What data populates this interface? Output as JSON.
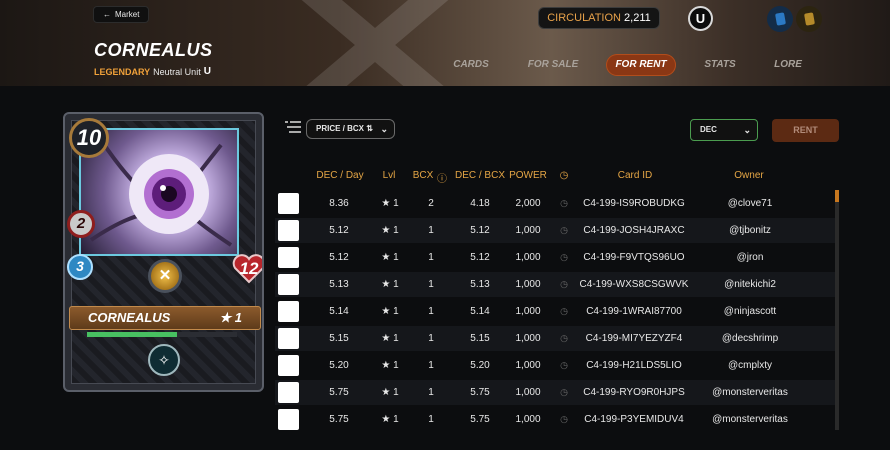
{
  "header": {
    "back_label": "Market",
    "title": "CORNEALUS",
    "rarity": "LEGENDARY",
    "unit_type": "Neutral Unit",
    "circulation_label": "CIRCULATION",
    "circulation_value": "2,211",
    "edition_glyph": "U",
    "tabs": [
      {
        "label": "CARDS",
        "active": false
      },
      {
        "label": "FOR SALE",
        "active": false
      },
      {
        "label": "FOR RENT",
        "active": true
      },
      {
        "label": "STATS",
        "active": false
      },
      {
        "label": "LORE",
        "active": false
      }
    ]
  },
  "card": {
    "mana": "10",
    "attack": "2",
    "speed": "3",
    "health": "12",
    "name": "CORNEALUS",
    "level": "★ 1",
    "xp_fraction": 0.6
  },
  "filters": {
    "sort_label": "PRICE / BCX",
    "currency_label": "DEC",
    "rent_label": "RENT"
  },
  "table": {
    "headers": [
      "DEC / Day",
      "Lvl",
      "BCX",
      "DEC / BCX",
      "POWER",
      "",
      "Card ID",
      "Owner"
    ],
    "rows": [
      {
        "dec_day": "8.36",
        "lvl": "★ 1",
        "bcx": "2",
        "dec_bcx": "4.18",
        "power": "2,000",
        "card_id": "C4-199-IS9ROBUDKG",
        "owner": "@clove71"
      },
      {
        "dec_day": "5.12",
        "lvl": "★ 1",
        "bcx": "1",
        "dec_bcx": "5.12",
        "power": "1,000",
        "card_id": "C4-199-JOSH4JRAXC",
        "owner": "@tjbonitz"
      },
      {
        "dec_day": "5.12",
        "lvl": "★ 1",
        "bcx": "1",
        "dec_bcx": "5.12",
        "power": "1,000",
        "card_id": "C4-199-F9VTQS96UO",
        "owner": "@jron"
      },
      {
        "dec_day": "5.13",
        "lvl": "★ 1",
        "bcx": "1",
        "dec_bcx": "5.13",
        "power": "1,000",
        "card_id": "C4-199-WXS8CSGWVK",
        "owner": "@nitekichi2"
      },
      {
        "dec_day": "5.14",
        "lvl": "★ 1",
        "bcx": "1",
        "dec_bcx": "5.14",
        "power": "1,000",
        "card_id": "C4-199-1WRAI87700",
        "owner": "@ninjascott"
      },
      {
        "dec_day": "5.15",
        "lvl": "★ 1",
        "bcx": "1",
        "dec_bcx": "5.15",
        "power": "1,000",
        "card_id": "C4-199-MI7YEZYZF4",
        "owner": "@decshrimp"
      },
      {
        "dec_day": "5.20",
        "lvl": "★ 1",
        "bcx": "1",
        "dec_bcx": "5.20",
        "power": "1,000",
        "card_id": "C4-199-H21LDS5LIO",
        "owner": "@cmplxty"
      },
      {
        "dec_day": "5.75",
        "lvl": "★ 1",
        "bcx": "1",
        "dec_bcx": "5.75",
        "power": "1,000",
        "card_id": "C4-199-RYO9R0HJPS",
        "owner": "@monsterveritas"
      },
      {
        "dec_day": "5.75",
        "lvl": "★ 1",
        "bcx": "1",
        "dec_bcx": "5.75",
        "power": "1,000",
        "card_id": "C4-199-P3YEMIDUV4",
        "owner": "@monsterveritas"
      }
    ]
  },
  "colors": {
    "accent": "#e4a545",
    "active_tab": "#8a3714",
    "rarity": "#f0a13a"
  }
}
